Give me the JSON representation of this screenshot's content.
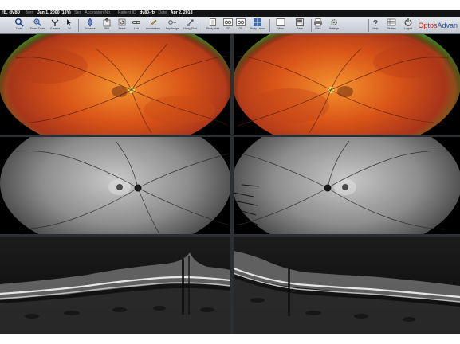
{
  "patient": {
    "patient_name": "rb, dv80",
    "born_label": "Born",
    "born_value": "Jan 1, 2000 (18Y)",
    "sex_label": "Sex",
    "accession_label": "Accession No.",
    "patient_id_label": "Patient ID",
    "patient_id_value": "dv80-rb",
    "date_label": "Date",
    "date_value": "Apr 2, 2018"
  },
  "toolbar": {
    "tools": [
      {
        "label": "Zoom",
        "icon": "magnifier-icon"
      },
      {
        "label": "Smart Zoom",
        "icon": "smart-zoom-icon"
      },
      {
        "label": "Gamma",
        "icon": "gamma-icon"
      },
      {
        "label": "W",
        "icon": "window-level-icon"
      },
      {
        "label": "Enhance",
        "icon": "enhance-icon"
      },
      {
        "label": "Stirl",
        "icon": "stirl-icon"
      },
      {
        "label": "Reset",
        "icon": "reset-icon"
      },
      {
        "label": "Link",
        "icon": "link-icon"
      },
      {
        "label": "Annotations",
        "icon": "annotations-icon"
      },
      {
        "label": "Key Image",
        "icon": "key-image-icon"
      },
      {
        "label": "Hang. Prot.",
        "icon": "hanging-protocol-icon"
      },
      {
        "label": "Study Note",
        "icon": "study-note-icon"
      },
      {
        "label": "OD",
        "icon": "od-icon"
      },
      {
        "label": "OS",
        "icon": "os-icon"
      },
      {
        "label": "Study Layout",
        "icon": "study-layout-icon"
      },
      {
        "label": "View",
        "icon": "view-icon"
      },
      {
        "label": "Save",
        "icon": "save-icon"
      },
      {
        "label": "Print",
        "icon": "print-icon"
      },
      {
        "label": "Settings",
        "icon": "settings-gear-icon"
      },
      {
        "label": "Help",
        "icon": "help-icon"
      },
      {
        "label": "Studies",
        "icon": "studies-icon"
      },
      {
        "label": "Logoff",
        "icon": "power-icon"
      }
    ],
    "brand_part1": "Optos",
    "brand_part2": "Advan"
  },
  "colors": {
    "brand_red": "#c3231f",
    "brand_blue": "#2f4f8f",
    "toolbar_bg": "#d4d8de",
    "separator": "#2b2e33"
  },
  "images": {
    "rows": [
      "color-widefield",
      "autofluorescence",
      "oct-bscan"
    ],
    "columns": [
      "right-eye-od",
      "left-eye-os"
    ]
  }
}
